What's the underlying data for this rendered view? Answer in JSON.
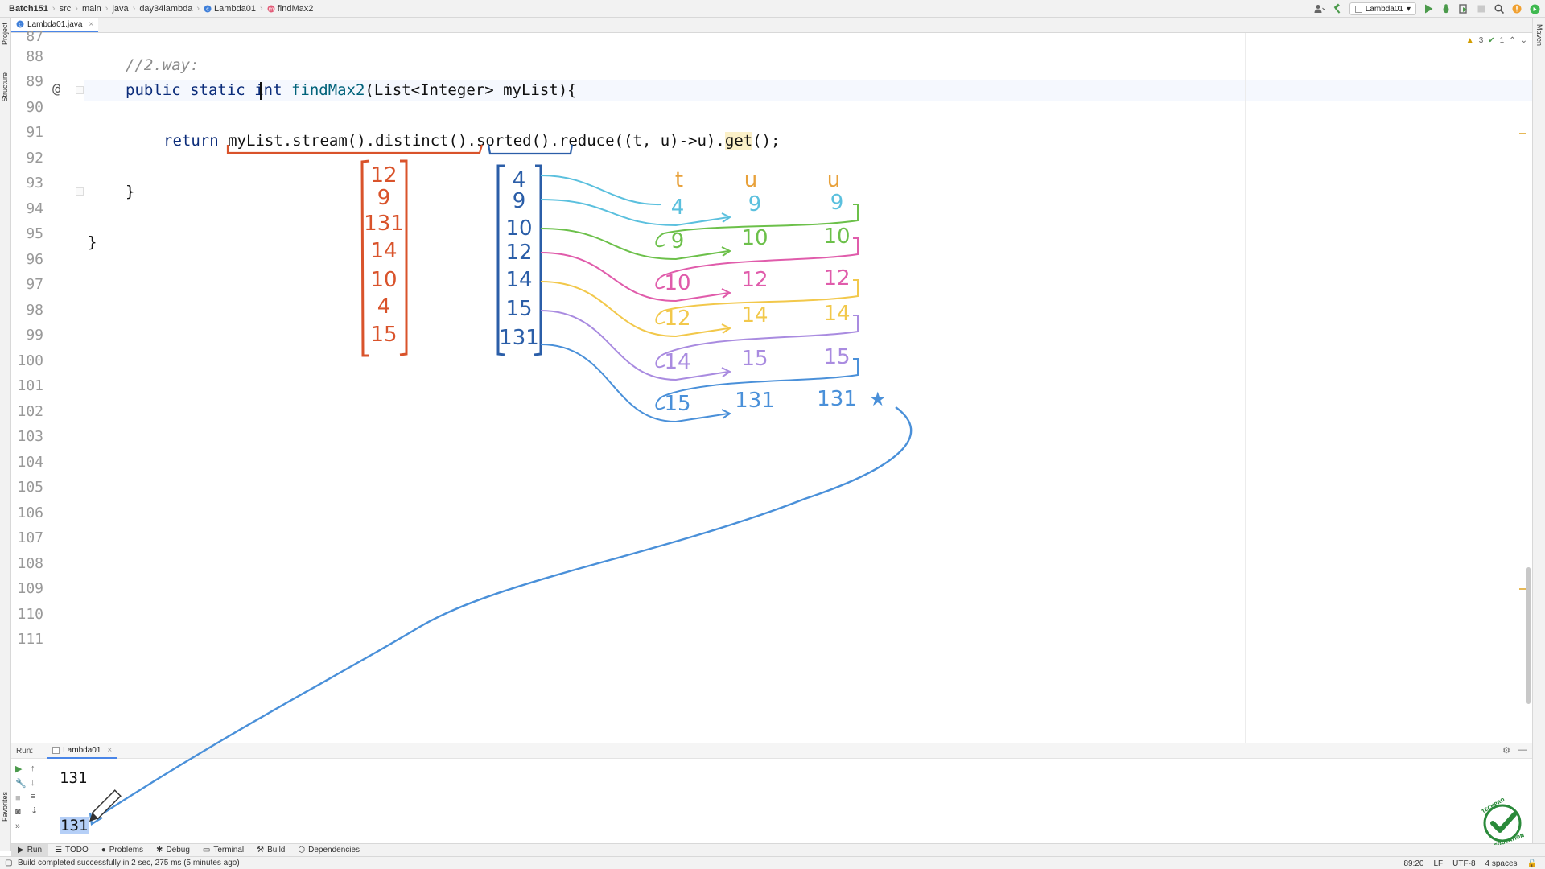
{
  "breadcrumb": [
    "Batch151",
    "src",
    "main",
    "java",
    "day34lambda",
    "Lambda01",
    "findMax2"
  ],
  "toolbar": {
    "run_config": "Lambda01"
  },
  "editor_tab": {
    "filename": "Lambda01.java"
  },
  "side_tabs": {
    "project": "Project",
    "structure": "Structure",
    "favorites": "Favorites",
    "maven": "Maven"
  },
  "inspections": {
    "warnings": "3",
    "ok": "1"
  },
  "line_numbers": [
    "87",
    "88",
    "89",
    "90",
    "91",
    "92",
    "93",
    "94",
    "95",
    "96",
    "97",
    "98",
    "99",
    "100",
    "101",
    "102",
    "103",
    "104",
    "105",
    "106",
    "107",
    "108",
    "109",
    "110",
    "111"
  ],
  "code": {
    "comment": "//2.way:",
    "sig_public": "public",
    "sig_static": "static",
    "sig_int": "int",
    "sig_name": "findMax2",
    "sig_rest": "(List<Integer> myList){",
    "ret_kw": "return",
    "ret_chain": "myList.stream().distinct().sorted().reduce((t, u)->u).",
    "ret_get": "get",
    "ret_end": "();",
    "close_method": "}",
    "close_class": "}",
    "gutter_at": "@"
  },
  "run_panel": {
    "label": "Run:",
    "tab": "Lambda01",
    "output": [
      "131",
      "131"
    ]
  },
  "tool_tabs": [
    "Run",
    "TODO",
    "Problems",
    "Debug",
    "Terminal",
    "Build",
    "Dependencies"
  ],
  "status": {
    "message": "Build completed successfully in 2 sec, 275 ms (5 minutes ago)",
    "position": "89:20",
    "line_sep": "LF",
    "encoding": "UTF-8",
    "indent": "4 spaces"
  },
  "annotations": {
    "original_list": [
      "12",
      "9",
      "131",
      "14",
      "10",
      "4",
      "15"
    ],
    "sorted_list": [
      "4",
      "9",
      "10",
      "12",
      "14",
      "15",
      "131"
    ],
    "col_headers": [
      "t",
      "u",
      "u"
    ],
    "reduce_steps": [
      {
        "t": "4",
        "u": "9",
        "r": "9",
        "color": "#5bc0de"
      },
      {
        "t": "9",
        "u": "10",
        "r": "10",
        "color": "#6cc04a"
      },
      {
        "t": "10",
        "u": "12",
        "r": "12",
        "color": "#e05cab"
      },
      {
        "t": "12",
        "u": "14",
        "r": "14",
        "color": "#f2c84b"
      },
      {
        "t": "14",
        "u": "15",
        "r": "15",
        "color": "#a98be0"
      },
      {
        "t": "15",
        "u": "131",
        "r": "131",
        "color": "#4a90d9"
      }
    ],
    "distinct_color": "#d9532b",
    "sorted_color": "#2b5ea8",
    "star": "★"
  },
  "logo": {
    "text": "TECHPRO EDUCATION"
  }
}
